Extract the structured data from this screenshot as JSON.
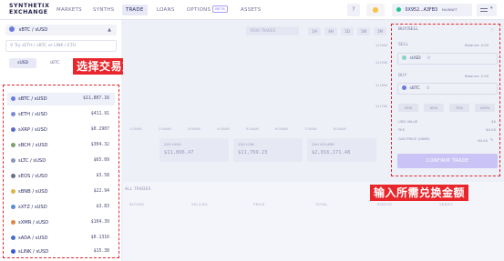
{
  "logo": {
    "line1": "SYNTHETIX",
    "line2": "EXCHANGE"
  },
  "nav": [
    {
      "label": "MARKETS"
    },
    {
      "label": "SYNTHS"
    },
    {
      "label": "TRADE"
    },
    {
      "label": "LOANS"
    },
    {
      "label": "OPTIONS",
      "badge": "BETA"
    },
    {
      "label": "ASSETS"
    }
  ],
  "topbar": {
    "help": "?",
    "wallet": "0X952...A3FB3",
    "network": "MAINNET"
  },
  "left": {
    "selected_pair": "sBTC / sUSD",
    "search_placeholder": "Try sETH / sBTC or LINK / ETH",
    "filters": [
      "sUSD",
      "sBTC"
    ],
    "pairs": [
      {
        "name": "sBTC / sUSD",
        "price": "$11,807.16"
      },
      {
        "name": "sETH / sUSD",
        "price": "$411.91"
      },
      {
        "name": "sXRP / sUSD",
        "price": "$0.2907"
      },
      {
        "name": "sBCH / sUSD",
        "price": "$304.32"
      },
      {
        "name": "sLTC / sUSD",
        "price": "$65.09"
      },
      {
        "name": "sEOS / sUSD",
        "price": "$3.58"
      },
      {
        "name": "sBNB / sUSD",
        "price": "$22.94"
      },
      {
        "name": "sXTZ / sUSD",
        "price": "$3.83"
      },
      {
        "name": "sXMR / sUSD",
        "price": "$104.39"
      },
      {
        "name": "sADA / sUSD",
        "price": "$0.1316"
      },
      {
        "name": "sLINK / sUSD",
        "price": "$15.38"
      }
    ]
  },
  "labels": {
    "select_pair": "选择交易对",
    "input_amount": "输入所需兑换金额"
  },
  "chart": {
    "your_trades": "YOUR TRADES",
    "timeframes": [
      "1H",
      "4H",
      "1D",
      "1W",
      "1M"
    ],
    "y_ticks": [
      "$12000",
      "$11900",
      "$11800",
      "$11700"
    ],
    "x_ticks": [
      "1:00AM",
      "2:00AM",
      "3:00AM",
      "4:00AM",
      "5:00AM",
      "6:00AM",
      "7:00AM",
      "8:00AM"
    ],
    "stats": [
      {
        "title": "24H HIGH",
        "value": "$11,896.47"
      },
      {
        "title": "24H LOW",
        "value": "$11,769.23"
      },
      {
        "title": "24H VOLUME",
        "value": "$2,016,171.48"
      }
    ]
  },
  "trades_table": {
    "title": "ALL TRADES",
    "headers": [
      "BUYING",
      "SELLING",
      "PRICE",
      "TOTAL",
      "STATUS",
      "VERIFY"
    ]
  },
  "order": {
    "title": "BUY/SELL",
    "sell_label": "SELL",
    "sell_balance": "Balance: 0.00",
    "sell_currency": "sUSD",
    "sell_amount": "0",
    "buy_label": "BUY",
    "buy_balance": "Balance: 0.00",
    "buy_currency": "sBTC",
    "buy_amount": "0",
    "percents": [
      "25%",
      "50%",
      "75%",
      "100%"
    ],
    "trade_value_label": "USD VALUE",
    "trade_value": "$0",
    "fee_label": "FEE",
    "fee_value": "$0.00",
    "gas_label": "GAS PRICE (GWEI)",
    "gas_value": "90.00",
    "confirm": "CONFIRM TRADE"
  },
  "colors": {
    "accent": "#e8262b",
    "brand": "#25254a",
    "purple": "#7b6bf0",
    "confirm": "#c9c4f5"
  }
}
